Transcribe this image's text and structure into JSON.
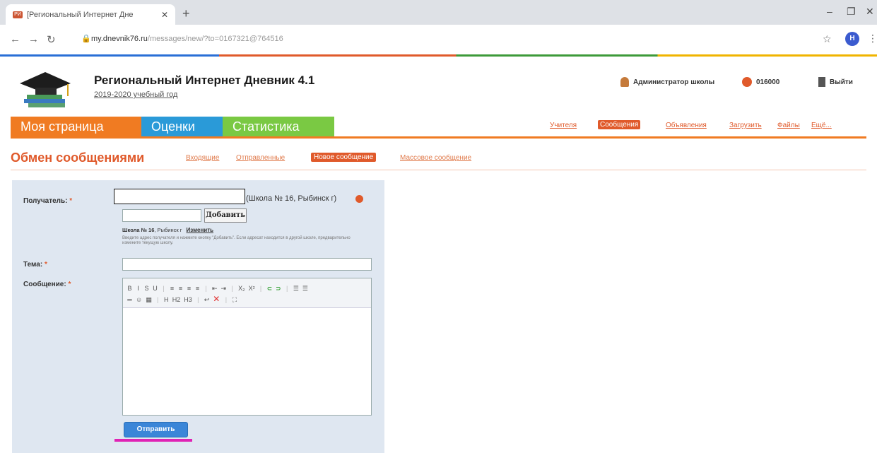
{
  "browser": {
    "tab_title": "[Региональный Интернет Дне",
    "tab_favicon_text": "РИ",
    "url_host": "my.dnevnik76.ru",
    "url_path": "/messages/new/?to=0167321@764516",
    "profile_initial": "Н"
  },
  "header": {
    "site_title": "Региональный Интернет Дневник 4.1",
    "school_year": "2019-2020 учебный год",
    "user_role": "Администратор школы",
    "school_code": "016000",
    "logout_label": "Выйти"
  },
  "main_tabs": [
    "Моя страница",
    "Оценки",
    "Статистика"
  ],
  "top_links": [
    "Учителя",
    "Сообщения",
    "Объявления",
    "Загрузить",
    "Файлы",
    "Ещё..."
  ],
  "section": {
    "title": "Обмен сообщениями",
    "sublinks": [
      "Входящие",
      "Отправленные",
      "Новое сообщение",
      "Массовое сообщение"
    ]
  },
  "form": {
    "recipient_label": "Получатель:",
    "required_mark": "*",
    "recipient_school": "(Школа № 16, Рыбинск г)",
    "add_button": "Добавить",
    "current_school": "Школа № 16",
    "current_city": ", Рыбинск г",
    "change_link": "Изменить",
    "hint": "Введите адрес получателя и нажмите кнопку \"Добавить\". Если адресат находится в другой школе, предварительно измените текущую школу.",
    "topic_label": "Тема:",
    "message_label": "Сообщение:",
    "toolbar_row1": [
      "B",
      "I",
      "S",
      "U",
      "|",
      "≡",
      "≡",
      "≡",
      "≡",
      "|",
      "⇤",
      "⇥",
      "|",
      "X₂",
      "X²",
      "|",
      "⊂",
      "⊃",
      "|",
      "☰",
      "☰"
    ],
    "toolbar_row2": [
      "═",
      "☺",
      "▦",
      "|",
      "H",
      "H2",
      "H3",
      "|",
      "↩",
      "✕",
      "|",
      "⛶"
    ],
    "send_button": "Отправить"
  },
  "colors": {
    "accent": "#e05a2b",
    "tab_orange": "#f07b22",
    "tab_blue": "#2a9ad8",
    "tab_green": "#7ac943",
    "panel_bg": "#dfe7f1",
    "send_button": "#3b86d8",
    "highlight_mark": "#e023b5"
  }
}
